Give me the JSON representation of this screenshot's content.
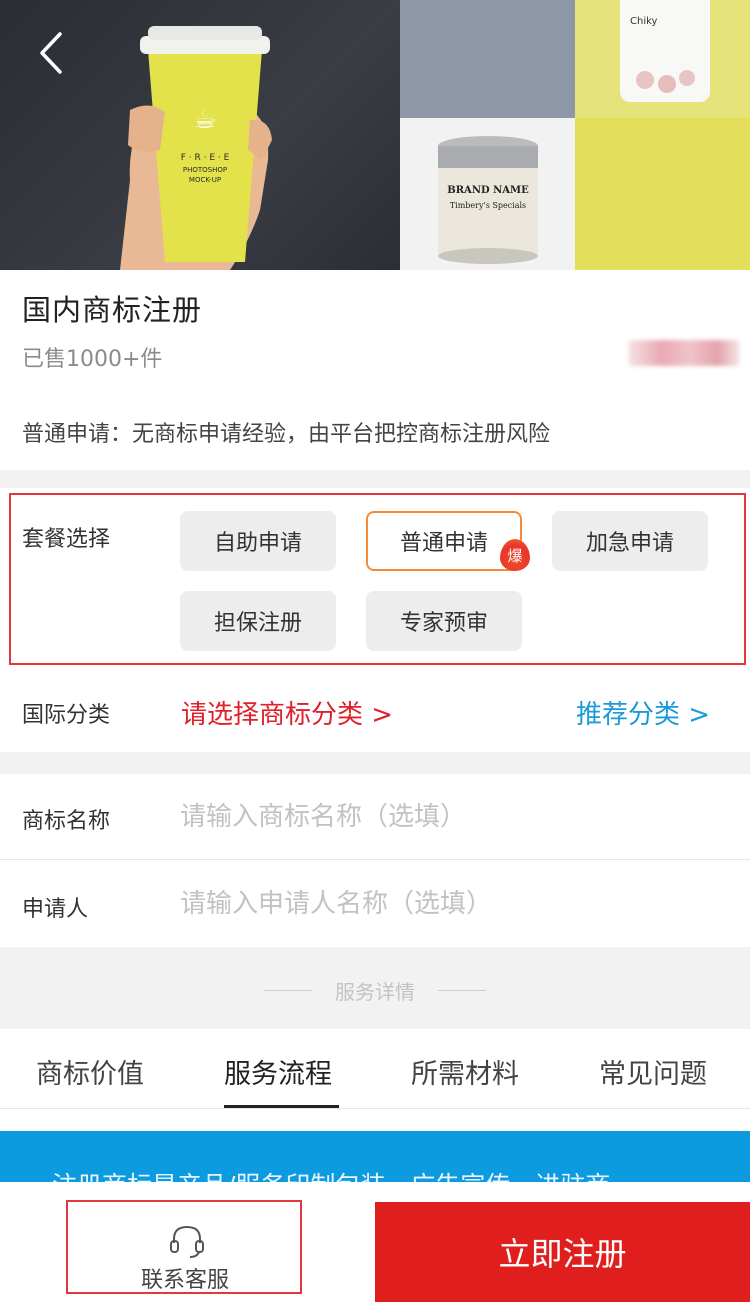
{
  "hero": {
    "cup_text": "FREE PHOTOSHOP MOCK-UP",
    "tin_text": "BRAND NAME",
    "box_text": "Chiky"
  },
  "product": {
    "title": "国内商标注册",
    "sold": "已售1000+件",
    "description": "普通申请：无商标申请经验，由平台把控商标注册风险"
  },
  "package": {
    "label": "套餐选择",
    "options": [
      {
        "label": "自助申请",
        "selected": false
      },
      {
        "label": "普通申请",
        "selected": true,
        "badge": "爆"
      },
      {
        "label": "加急申请",
        "selected": false
      },
      {
        "label": "担保注册",
        "selected": false
      },
      {
        "label": "专家预审",
        "selected": false
      }
    ]
  },
  "classification": {
    "label": "国际分类",
    "pick_text": "请选择商标分类  >",
    "recommend_text": "推荐分类  >"
  },
  "form": {
    "trademark_name": {
      "label": "商标名称",
      "placeholder": "请输入商标名称（选填）",
      "value": ""
    },
    "applicant": {
      "label": "申请人",
      "placeholder": "请输入申请人名称（选填）",
      "value": ""
    }
  },
  "service": {
    "section_title": "服务详情",
    "tabs": [
      {
        "label": "商标价值",
        "active": false
      },
      {
        "label": "服务流程",
        "active": true
      },
      {
        "label": "所需材料",
        "active": false
      },
      {
        "label": "常见问题",
        "active": false
      }
    ],
    "banner_text": "注册商标是产品/服务印制包装、广告宣传、进驻商"
  },
  "bottom": {
    "customer_service": "联系客服",
    "cta": "立即注册"
  },
  "colors": {
    "accent_red": "#e01e1e",
    "link_blue": "#1a9ad6",
    "banner_blue": "#0d9be0",
    "selected_border": "#f28c3a"
  }
}
